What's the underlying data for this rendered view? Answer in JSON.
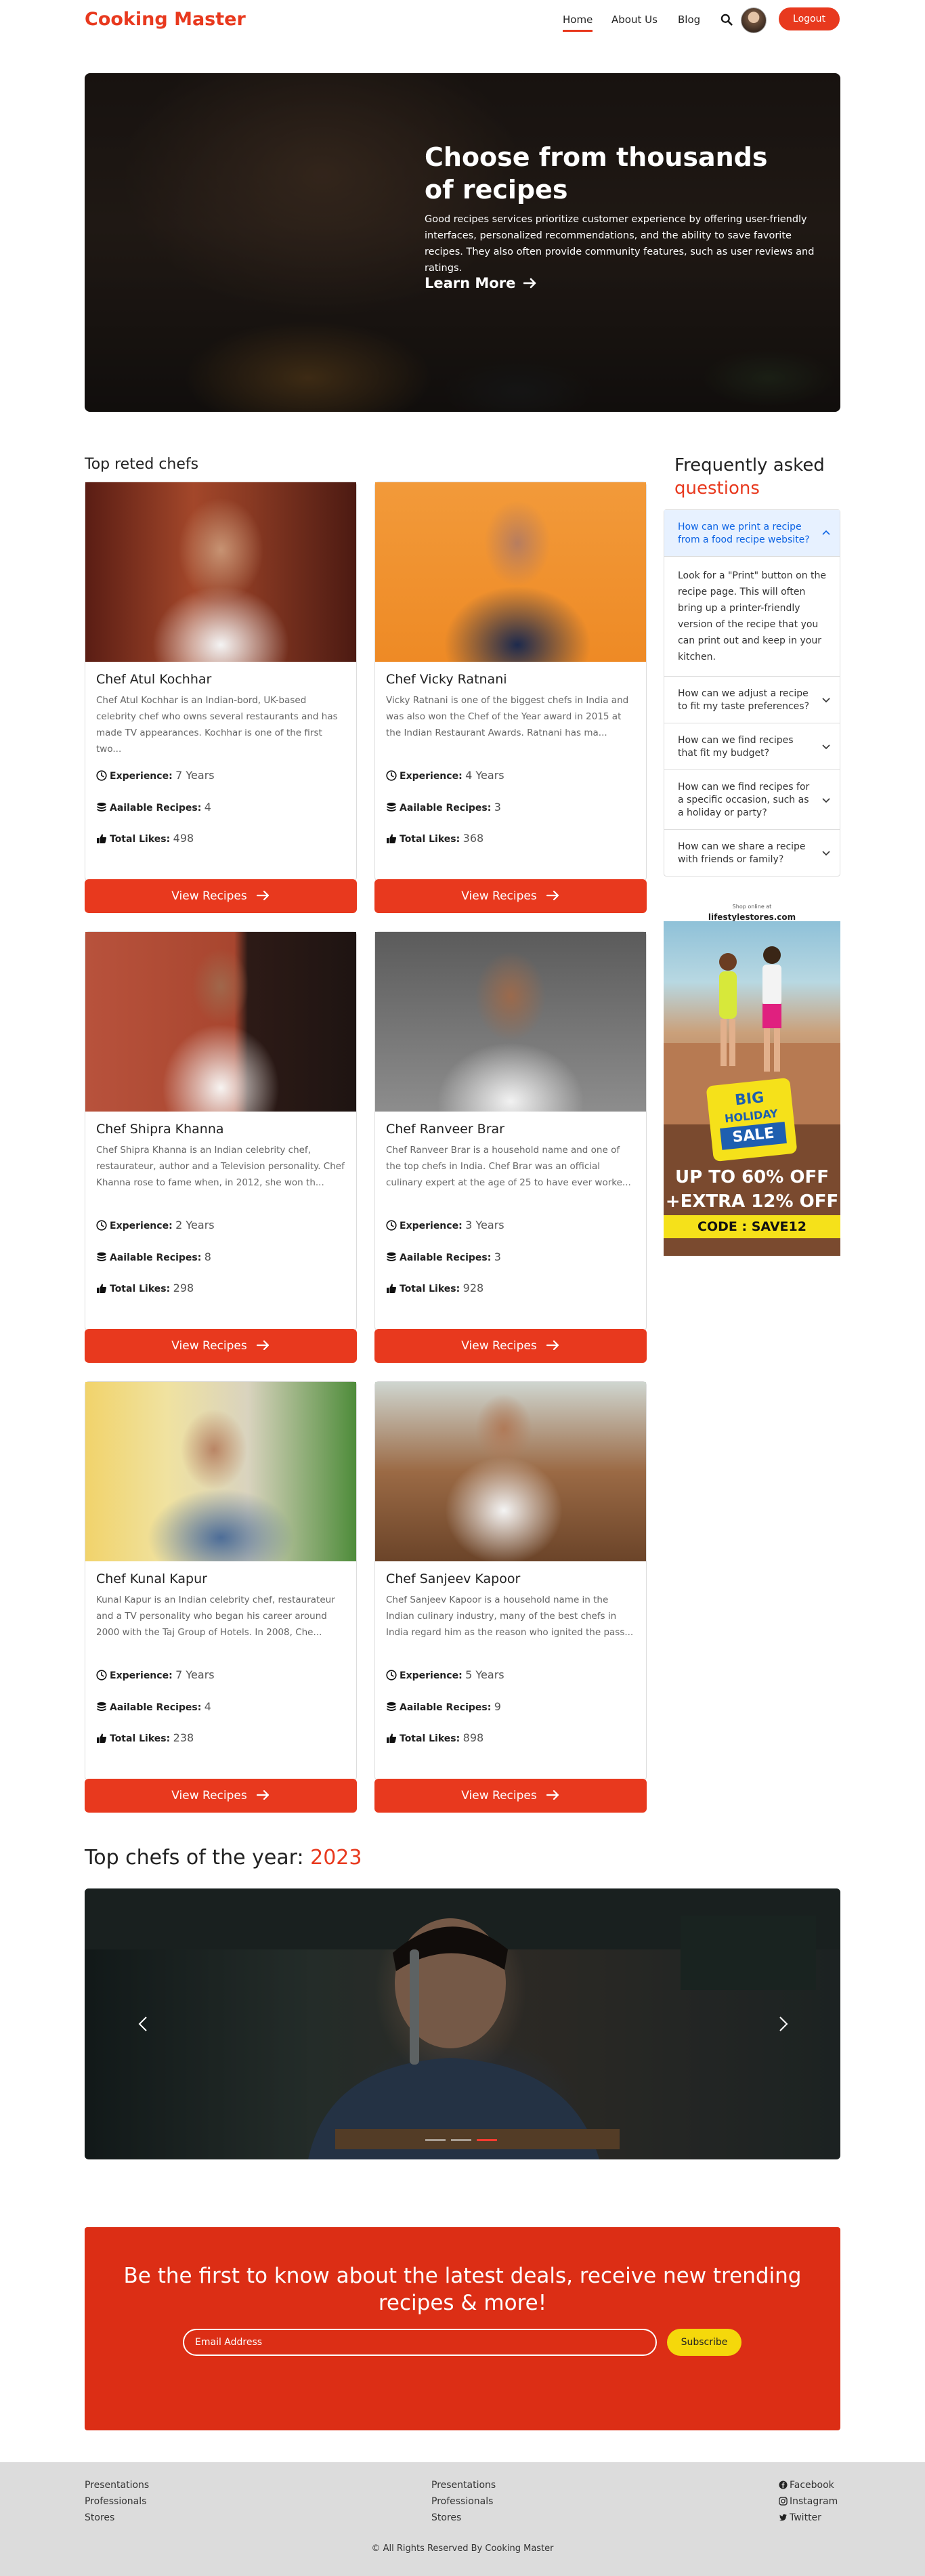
{
  "nav": {
    "brand": "Cooking Master",
    "links": [
      "Home",
      "About Us",
      "Blog"
    ],
    "logout": "Logout"
  },
  "hero": {
    "title": "Choose from thousands of recipes",
    "text": "Good recipes services prioritize customer experience by offering user-friendly interfaces, personalized recommendations, and the ability to save favorite recipes. They also often provide community features, such as user reviews and ratings.",
    "button": "Learn More"
  },
  "chefs_section": {
    "title": "Top reted chefs",
    "labels": {
      "experience": "Experience:",
      "recipes": "Aailable Recipes:",
      "likes": "Total Likes:",
      "button": "View Recipes"
    },
    "chefs": [
      {
        "name": "Chef Atul Kochhar",
        "desc": "Chef Atul Kochhar is an Indian-bord, UK-based celebrity chef who owns several restaurants and has made TV appearances. Kochhar is one of the first two...",
        "experience": "7 Years",
        "recipes": "4",
        "likes": "498"
      },
      {
        "name": "Chef Vicky Ratnani",
        "desc": "Vicky Ratnani is one of the biggest chefs in India and was also won the Chef of the Year award in 2015 at the Indian Restaurant Awards. Ratnani has ma...",
        "experience": "4 Years",
        "recipes": "3",
        "likes": "368"
      },
      {
        "name": "Chef Shipra Khanna",
        "desc": "Chef Shipra Khanna is an Indian celebrity chef, restaurateur, author and a Television personality. Chef Khanna rose to fame when, in 2012, she won th...",
        "experience": "2 Years",
        "recipes": "8",
        "likes": "298"
      },
      {
        "name": "Chef Ranveer Brar",
        "desc": "Chef Ranveer Brar is a household name and one of the top chefs in India. Chef Brar was an official culinary expert at the age of 25 to have ever worke...",
        "experience": "3 Years",
        "recipes": "3",
        "likes": "928"
      },
      {
        "name": "Chef Kunal Kapur",
        "desc": "Kunal Kapur is an Indian celebrity chef, restaurateur and a TV personality who began his career around 2000 with the Taj Group of Hotels. In 2008, Che...",
        "experience": "7 Years",
        "recipes": "4",
        "likes": "238"
      },
      {
        "name": "Chef Sanjeev Kapoor",
        "desc": "Chef Sanjeev Kapoor is a household name in the Indian culinary industry, many of the best chefs in India regard him as the reason who ignited the pass...",
        "experience": "5 Years",
        "recipes": "9",
        "likes": "898"
      }
    ]
  },
  "faq": {
    "title1": "Frequently asked",
    "title2": "questions",
    "items": [
      {
        "q": "How can we print a recipe from a food recipe website?",
        "a": "Look for a \"Print\" button on the recipe page. This will often bring up a printer-friendly version of the recipe that you can print out and keep in your kitchen."
      },
      {
        "q": "How can we adjust a recipe to fit my taste preferences?"
      },
      {
        "q": "How can we find recipes that fit my budget?"
      },
      {
        "q": "How can we find recipes for a specific occasion, such as a holiday or party?"
      },
      {
        "q": "How can we share a recipe with friends or family?"
      }
    ]
  },
  "ad": {
    "shop": "Shop online at",
    "brand": "lifestylestores.com",
    "big": "BIG",
    "holiday": "HOLIDAY",
    "sale": "SALE",
    "upto": "UP TO 60% OFF",
    "extra": "+EXTRA 12% OFF",
    "code": "CODE : SAVE12"
  },
  "year_section": {
    "title": "Top chefs of the year: ",
    "year": "2023",
    "slides": 3,
    "active_slide": 3
  },
  "newsletter": {
    "title": "Be the first to know about the latest deals, receive new trending recipes & more!",
    "placeholder": "Email Address",
    "button": "Subscribe"
  },
  "footer": {
    "col1": [
      "Presentations",
      "Professionals",
      "Stores"
    ],
    "col2": [
      "Presentations",
      "Professionals",
      "Stores"
    ],
    "social": [
      "Facebook",
      "Instagram",
      "Twitter"
    ],
    "copyright": "© All Rights Reserved By Cooking Master"
  },
  "colors": {
    "accent": "#e8391e",
    "newsletter_bg": "#dc2e15",
    "subscribe": "#f5d80b",
    "faq_open_bg": "#e7f1ff"
  }
}
